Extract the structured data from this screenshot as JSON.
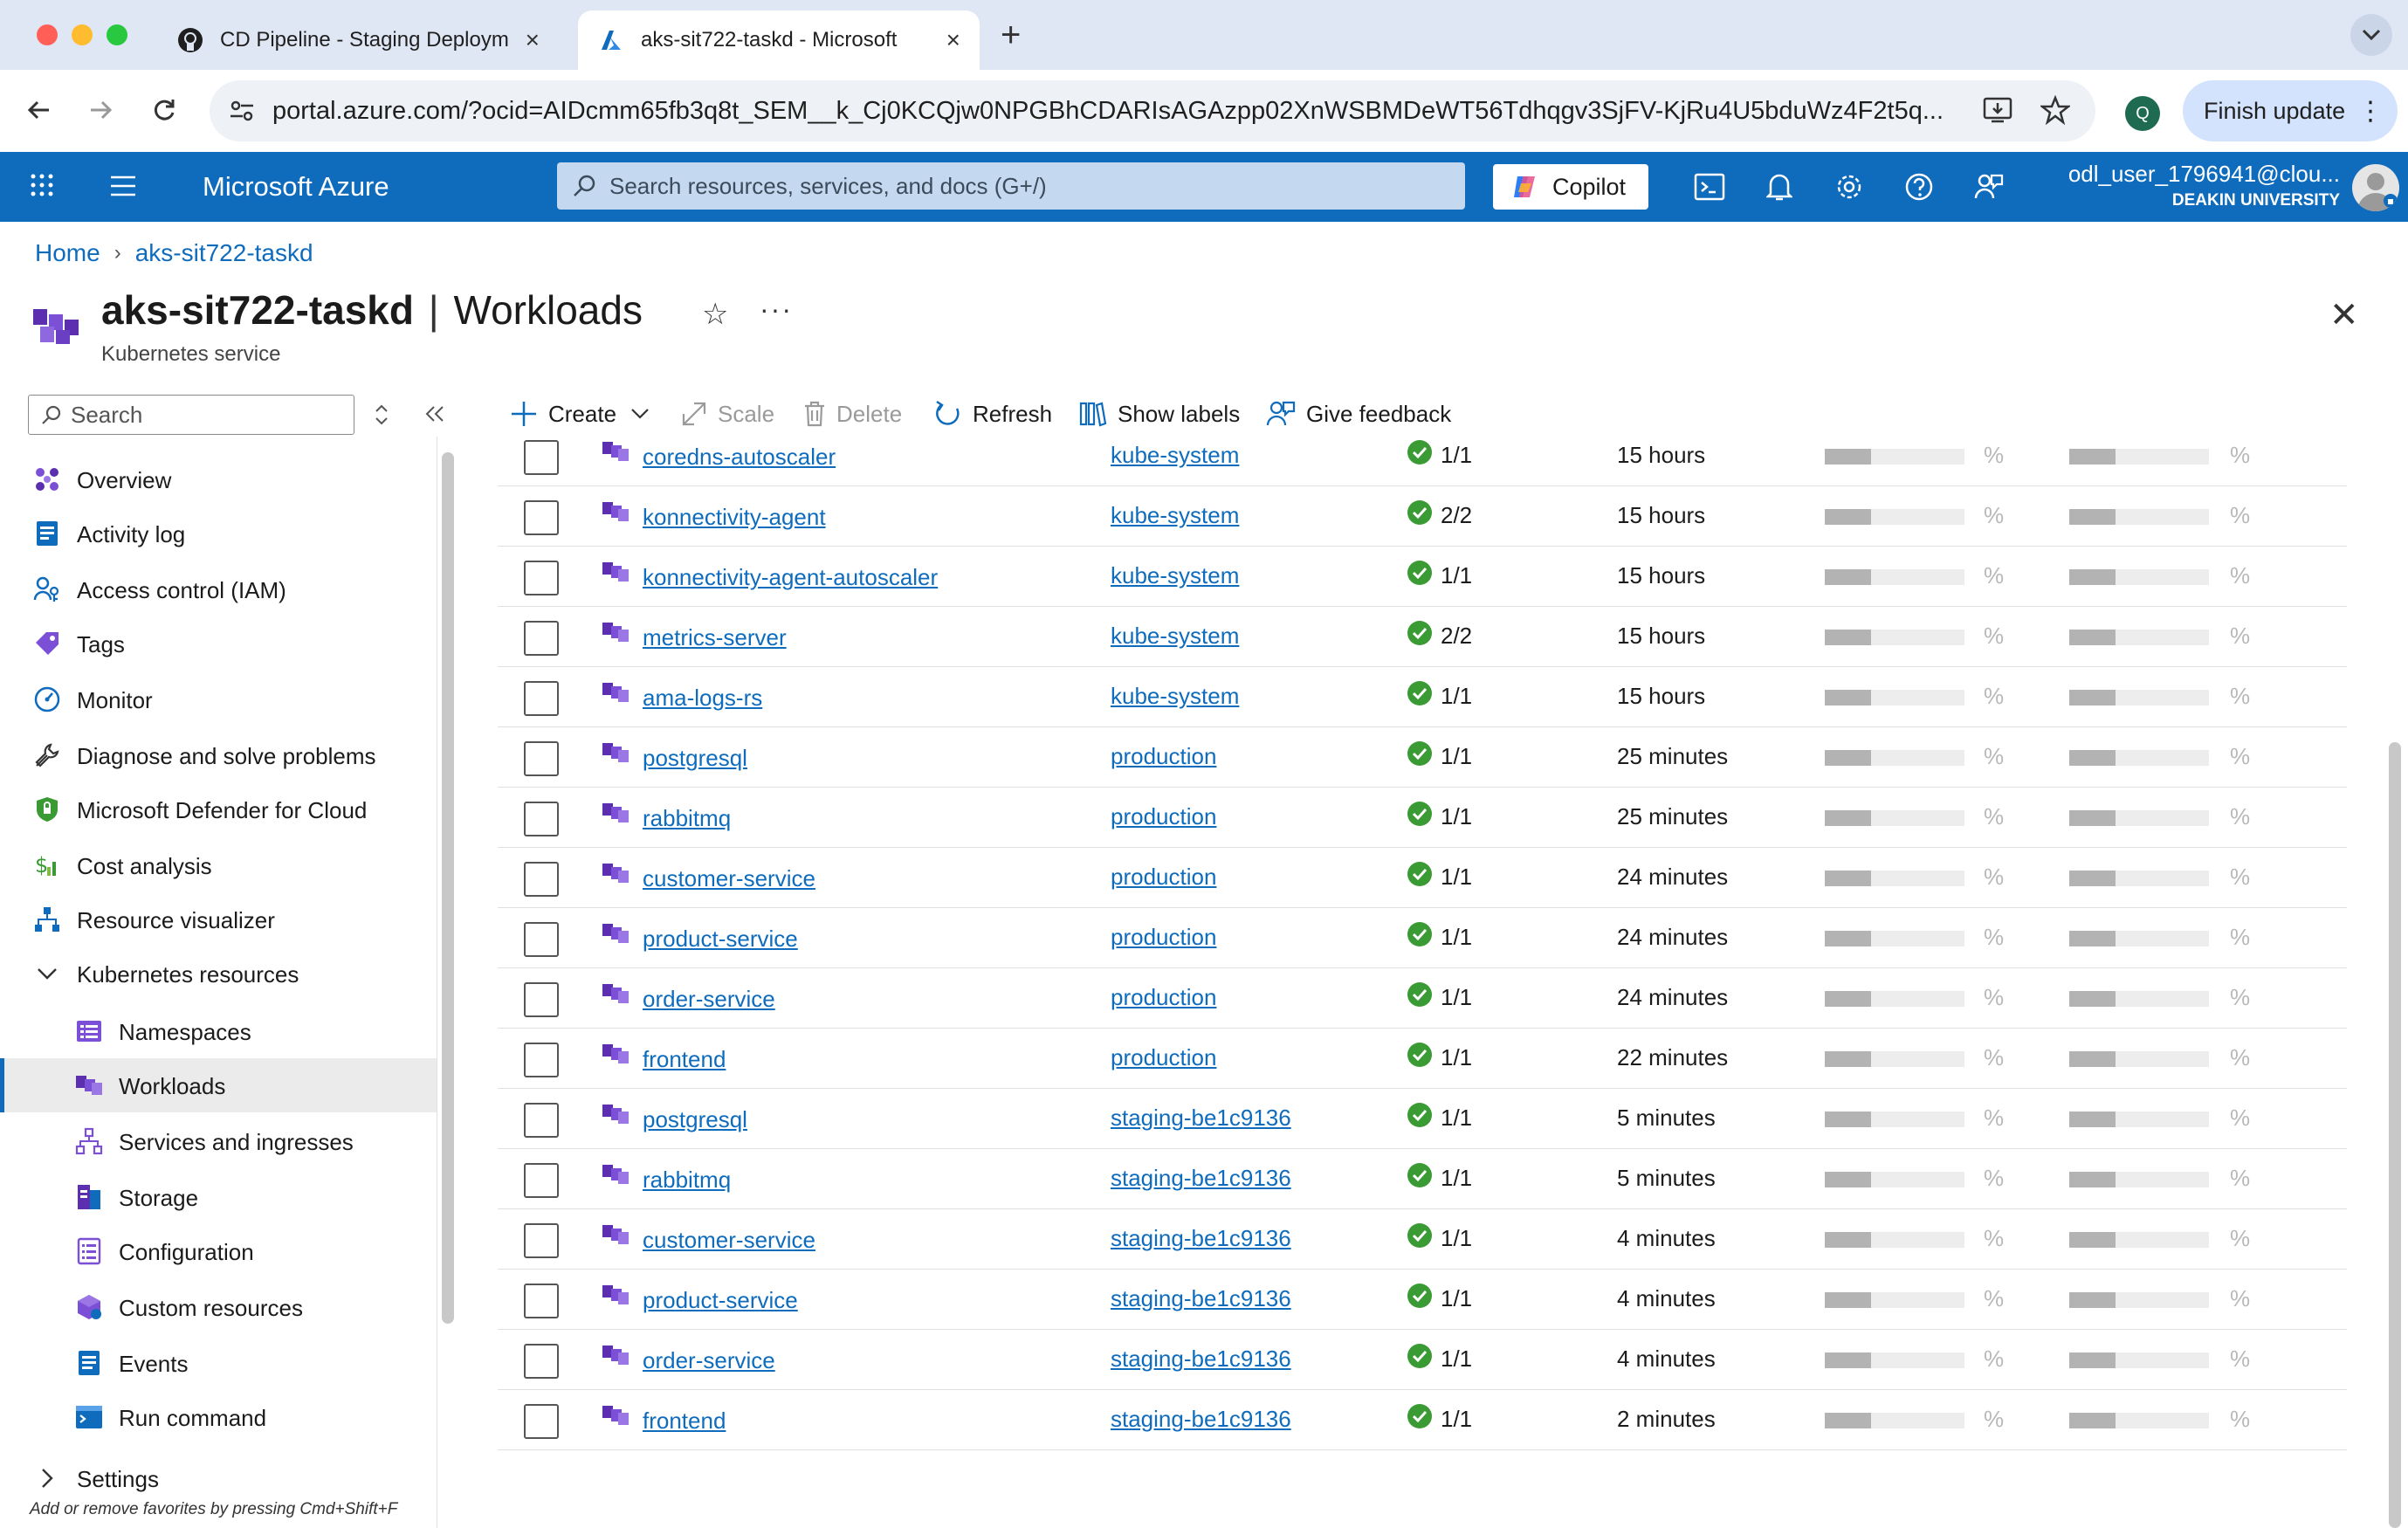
{
  "browser": {
    "tabs": [
      {
        "title": "CD Pipeline - Staging Deploym",
        "icon": "github-icon"
      },
      {
        "title": "aks-sit722-taskd - Microsoft",
        "icon": "azure-icon"
      }
    ],
    "url": "portal.azure.com/?ocid=AIDcmm65fb3q8t_SEM__k_Cj0KCQjw0NPGBhCDARIsAGAzpp02XnWSBMDeWT56Tdhqgv3SjFV-KjRu4U5bduWz4F2t5q...",
    "profile_initial": "Q",
    "finish_update_label": "Finish update"
  },
  "azure": {
    "brand": "Microsoft Azure",
    "search_placeholder": "Search resources, services, and docs (G+/)",
    "copilot_label": "Copilot",
    "user_name": "odl_user_1796941@clou...",
    "user_org": "DEAKIN UNIVERSITY"
  },
  "breadcrumb": {
    "home": "Home",
    "resource": "aks-sit722-taskd"
  },
  "header": {
    "resource_name": "aks-sit722-taskd",
    "separator": "|",
    "blade": "Workloads",
    "subtitle": "Kubernetes service"
  },
  "sidebar": {
    "search_placeholder": "Search",
    "items": [
      {
        "label": "Overview",
        "icon": "overview-icon"
      },
      {
        "label": "Activity log",
        "icon": "activity-log-icon"
      },
      {
        "label": "Access control (IAM)",
        "icon": "iam-icon"
      },
      {
        "label": "Tags",
        "icon": "tag-icon"
      },
      {
        "label": "Monitor",
        "icon": "monitor-icon"
      },
      {
        "label": "Diagnose and solve problems",
        "icon": "wrench-icon"
      },
      {
        "label": "Microsoft Defender for Cloud",
        "icon": "shield-icon"
      },
      {
        "label": "Cost analysis",
        "icon": "cost-icon"
      },
      {
        "label": "Resource visualizer",
        "icon": "visualizer-icon"
      },
      {
        "label": "Kubernetes resources",
        "icon": "chevron-down-icon"
      },
      {
        "label": "Namespaces",
        "icon": "namespaces-icon"
      },
      {
        "label": "Workloads",
        "icon": "workloads-icon"
      },
      {
        "label": "Services and ingresses",
        "icon": "services-icon"
      },
      {
        "label": "Storage",
        "icon": "storage-icon"
      },
      {
        "label": "Configuration",
        "icon": "configuration-icon"
      },
      {
        "label": "Custom resources",
        "icon": "custom-resources-icon"
      },
      {
        "label": "Events",
        "icon": "events-icon"
      },
      {
        "label": "Run command",
        "icon": "run-command-icon"
      },
      {
        "label": "Settings",
        "icon": "chevron-right-icon"
      }
    ],
    "favorites_hint": "Add or remove favorites by pressing Cmd+Shift+F"
  },
  "commands": {
    "create": "Create",
    "scale": "Scale",
    "delete": "Delete",
    "refresh": "Refresh",
    "show_labels": "Show labels",
    "give_feedback": "Give feedback"
  },
  "table": {
    "percent_symbol": "%",
    "usage_fraction": 0.33,
    "rows": [
      {
        "name": "coredns-autoscaler",
        "namespace": "kube-system",
        "ready": "1/1",
        "age": "15 hours"
      },
      {
        "name": "konnectivity-agent",
        "namespace": "kube-system",
        "ready": "2/2",
        "age": "15 hours"
      },
      {
        "name": "konnectivity-agent-autoscaler",
        "namespace": "kube-system",
        "ready": "1/1",
        "age": "15 hours"
      },
      {
        "name": "metrics-server",
        "namespace": "kube-system",
        "ready": "2/2",
        "age": "15 hours"
      },
      {
        "name": "ama-logs-rs",
        "namespace": "kube-system",
        "ready": "1/1",
        "age": "15 hours"
      },
      {
        "name": "postgresql",
        "namespace": "production",
        "ready": "1/1",
        "age": "25 minutes"
      },
      {
        "name": "rabbitmq",
        "namespace": "production",
        "ready": "1/1",
        "age": "25 minutes"
      },
      {
        "name": "customer-service",
        "namespace": "production",
        "ready": "1/1",
        "age": "24 minutes"
      },
      {
        "name": "product-service",
        "namespace": "production",
        "ready": "1/1",
        "age": "24 minutes"
      },
      {
        "name": "order-service",
        "namespace": "production",
        "ready": "1/1",
        "age": "24 minutes"
      },
      {
        "name": "frontend",
        "namespace": "production",
        "ready": "1/1",
        "age": "22 minutes"
      },
      {
        "name": "postgresql",
        "namespace": "staging-be1c9136",
        "ready": "1/1",
        "age": "5 minutes"
      },
      {
        "name": "rabbitmq",
        "namespace": "staging-be1c9136",
        "ready": "1/1",
        "age": "5 minutes"
      },
      {
        "name": "customer-service",
        "namespace": "staging-be1c9136",
        "ready": "1/1",
        "age": "4 minutes"
      },
      {
        "name": "product-service",
        "namespace": "staging-be1c9136",
        "ready": "1/1",
        "age": "4 minutes"
      },
      {
        "name": "order-service",
        "namespace": "staging-be1c9136",
        "ready": "1/1",
        "age": "4 minutes"
      },
      {
        "name": "frontend",
        "namespace": "staging-be1c9136",
        "ready": "1/1",
        "age": "2 minutes"
      }
    ]
  },
  "colors": {
    "azure_blue": "#0f6cbd",
    "status_green": "#3a9a33",
    "workload_purple": "#6b3fc4"
  }
}
